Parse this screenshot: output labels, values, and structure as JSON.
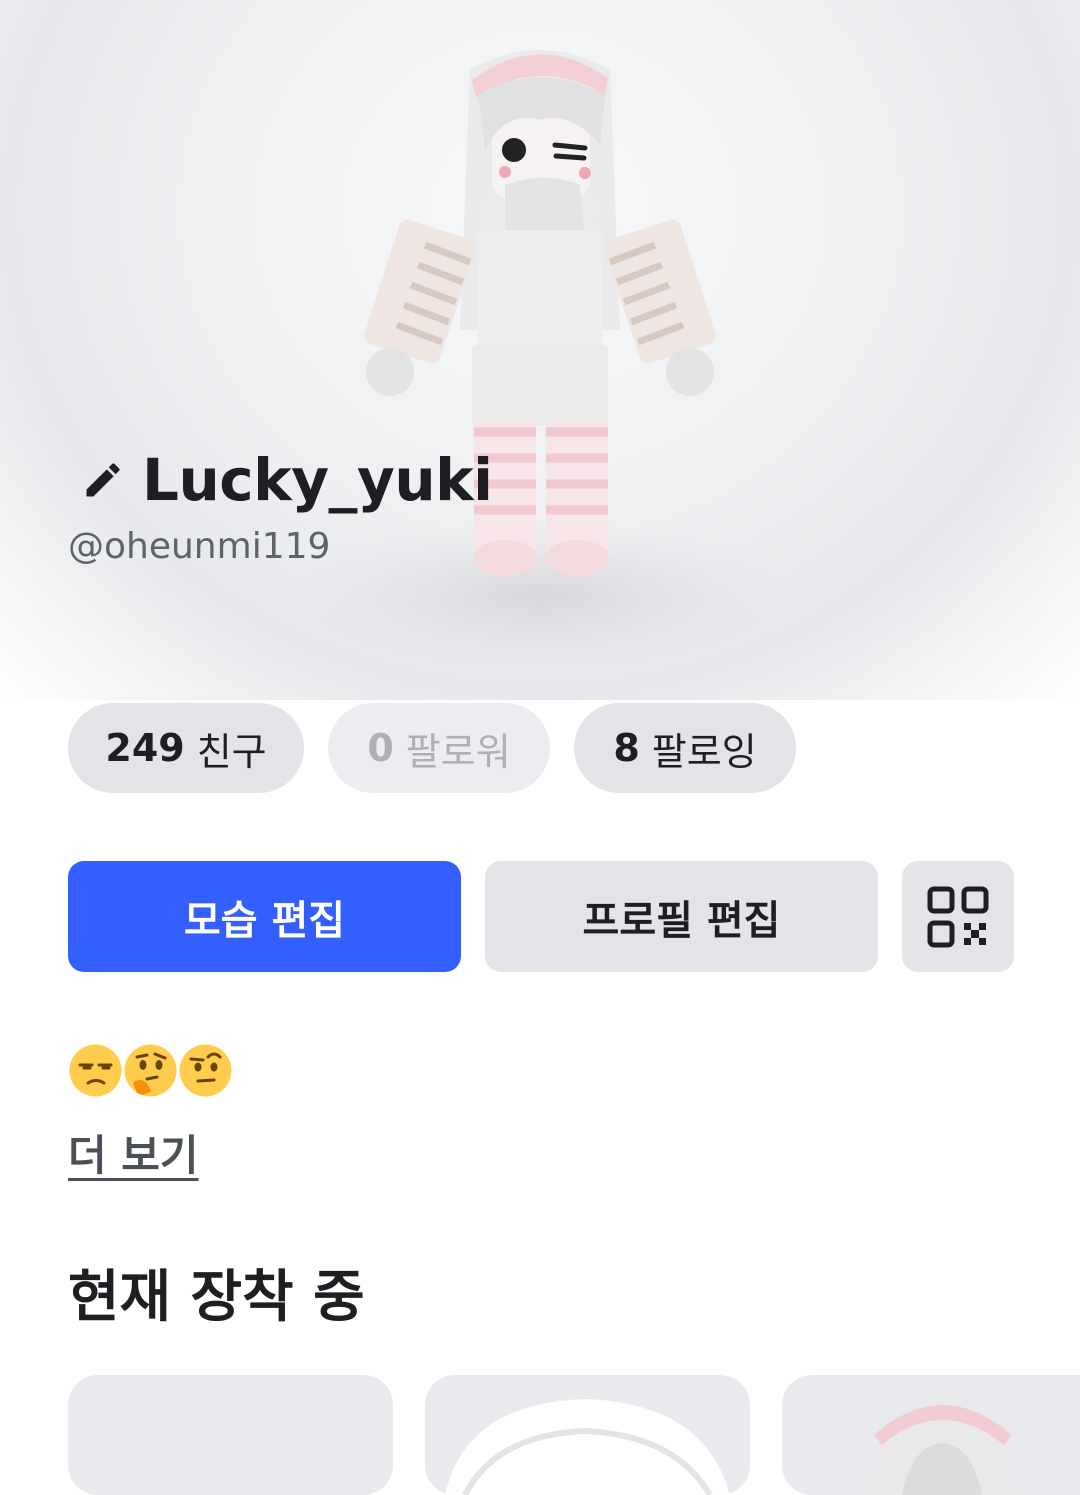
{
  "profile": {
    "display_name": "Lucky_yuki",
    "username": "@oheunmi119"
  },
  "stats": {
    "friends": {
      "count": "249",
      "label": "친구"
    },
    "followers": {
      "count": "0",
      "label": "팔로워"
    },
    "following": {
      "count": "8",
      "label": "팔로잉"
    }
  },
  "actions": {
    "edit_avatar_label": "모습 편집",
    "edit_profile_label": "프로필 편집",
    "qr_icon": "qr-code-icon"
  },
  "about": {
    "emojis": [
      "unamused-face",
      "thinking-face",
      "face-with-raised-eyebrow"
    ],
    "see_more_label": "더 보기"
  },
  "wearing": {
    "title": "현재 장착 중",
    "items": [
      "hat-item",
      "hair-item",
      "accessory-item"
    ]
  },
  "colors": {
    "primary": "#335fff",
    "chip_bg": "#e3e4e8",
    "text": "#1d1f23",
    "muted": "#5f6369"
  }
}
